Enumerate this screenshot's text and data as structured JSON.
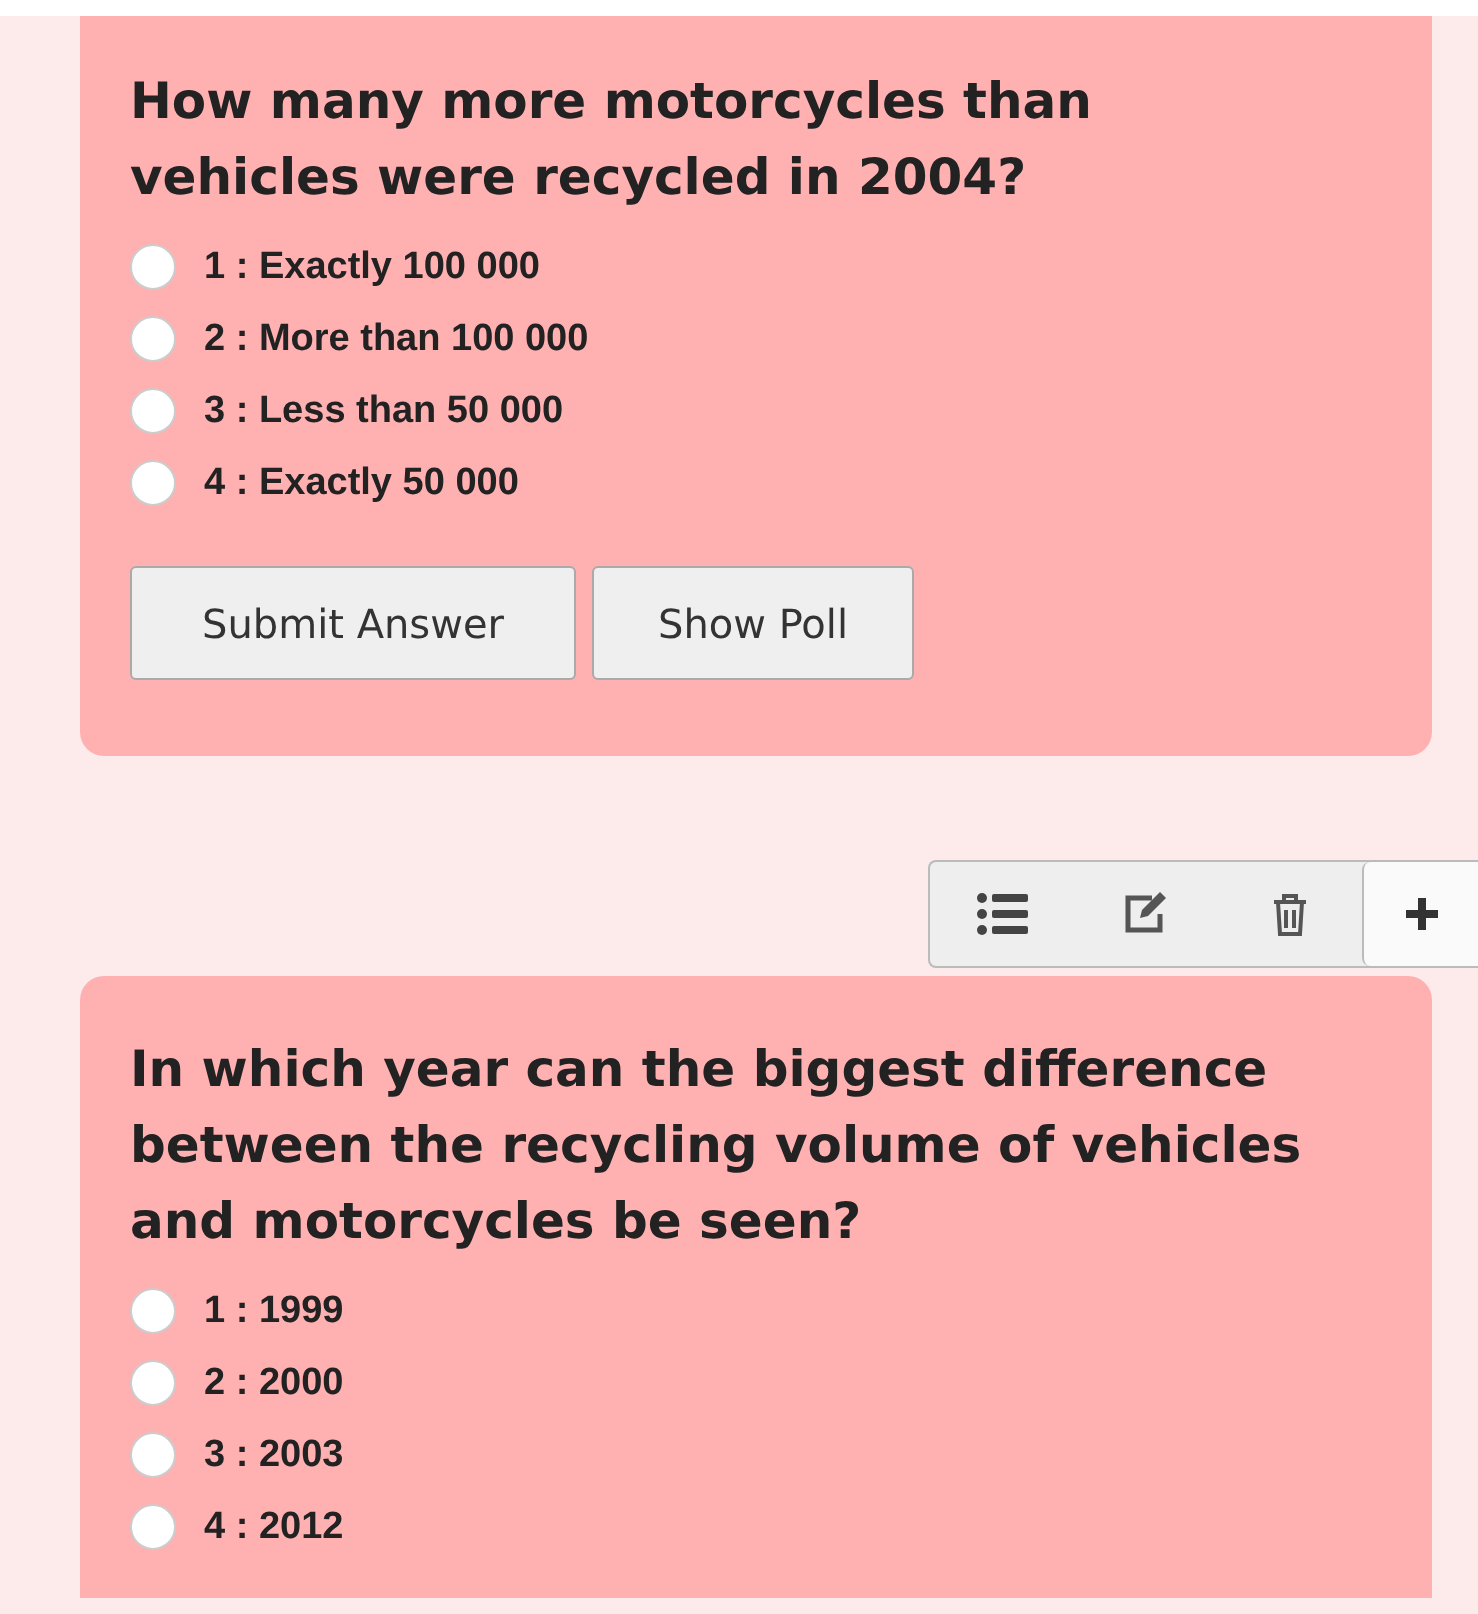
{
  "questions": [
    {
      "question": "How many more motorcycles than vehicles were recycled in 2004?",
      "options": [
        {
          "label": "1 : Exactly 100 000",
          "selected": false
        },
        {
          "label": "2 : More than 100 000",
          "selected": false
        },
        {
          "label": "3 : Less than 50 000",
          "selected": false
        },
        {
          "label": "4 : Exactly 50 000",
          "selected": false
        }
      ],
      "buttons": [
        "Submit Answer",
        "Show Poll"
      ]
    },
    {
      "question": "In which year can the biggest difference between the recycling volume of vehicles and motorcycles be seen?",
      "options": [
        {
          "label": "1 : 1999",
          "selected": false
        },
        {
          "label": "2 : 2000",
          "selected": false
        },
        {
          "label": "3 : 2003",
          "selected": false
        },
        {
          "label": "4 : 2012",
          "selected": false
        }
      ]
    }
  ],
  "toolbar": [
    {
      "kind": "list"
    },
    {
      "kind": "edit"
    },
    {
      "kind": "delete"
    },
    {
      "kind": "add"
    }
  ]
}
